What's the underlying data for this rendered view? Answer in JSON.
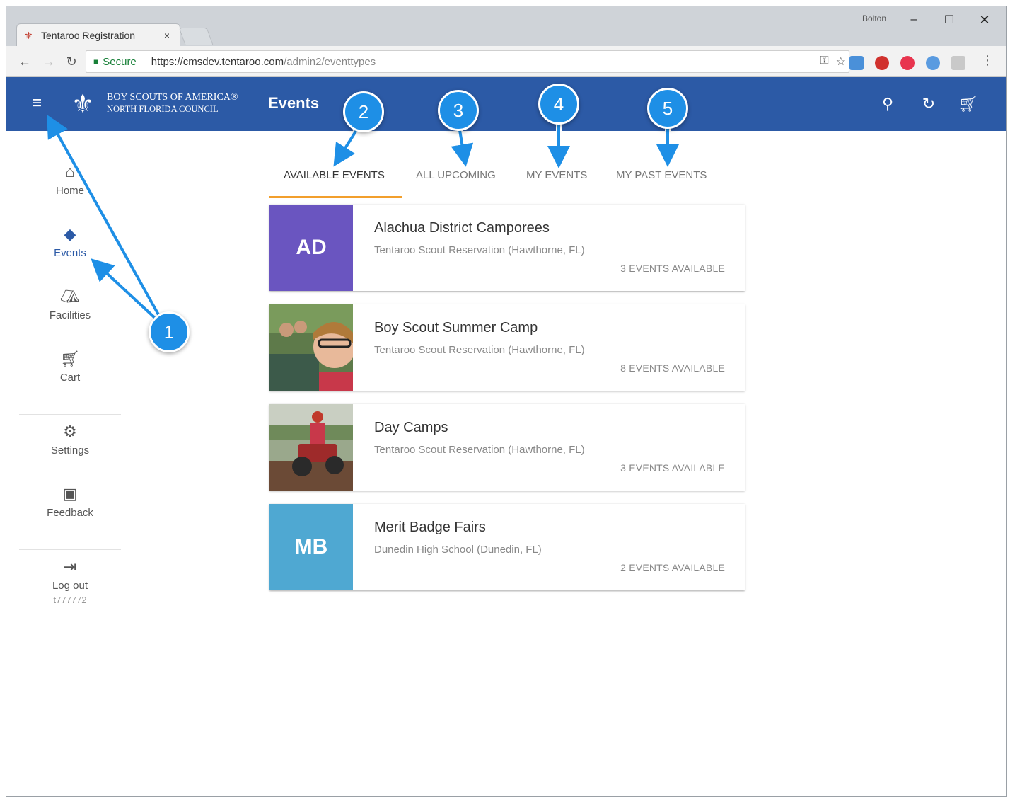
{
  "browser": {
    "tab_title": "Tentaroo Registration",
    "tab_close": "×",
    "user_chip": "Bolton",
    "window_min": "–",
    "window_max": "☐",
    "window_close": "✕",
    "secure_label": "Secure",
    "url_host": "https://cmsdev.tentaroo.com",
    "url_path": "/admin2/eventtypes"
  },
  "appbar": {
    "org_line1": "BOY SCOUTS OF AMERICA®",
    "org_line2": "NORTH FLORIDA COUNCIL",
    "title": "Events"
  },
  "sidebar": {
    "items": [
      {
        "label": "Home",
        "icon": "home-icon"
      },
      {
        "label": "Events",
        "icon": "events-icon",
        "active": true
      },
      {
        "label": "Facilities",
        "icon": "tent-icon"
      },
      {
        "label": "Cart",
        "icon": "cart-icon"
      },
      {
        "label": "Settings",
        "icon": "gear-icon"
      },
      {
        "label": "Feedback",
        "icon": "feedback-icon"
      },
      {
        "label": "Log out",
        "icon": "logout-icon"
      }
    ],
    "logout_id": "t777772"
  },
  "tabs": [
    {
      "label": "AVAILABLE EVENTS",
      "active": true
    },
    {
      "label": "ALL UPCOMING"
    },
    {
      "label": "MY EVENTS"
    },
    {
      "label": "MY PAST EVENTS"
    }
  ],
  "cards": [
    {
      "initials": "AD",
      "title": "Alachua District Camporees",
      "location": "Tentaroo Scout Reservation (Hawthorne, FL)",
      "count": "3 EVENTS AVAILABLE",
      "color": "#6a55c0"
    },
    {
      "initials": "",
      "title": "Boy Scout Summer Camp",
      "location": "Tentaroo Scout Reservation (Hawthorne, FL)",
      "count": "8 EVENTS AVAILABLE",
      "photo": "summer-camp-photo"
    },
    {
      "initials": "",
      "title": "Day Camps",
      "location": "Tentaroo Scout Reservation (Hawthorne, FL)",
      "count": "3 EVENTS AVAILABLE",
      "photo": "day-camp-photo"
    },
    {
      "initials": "MB",
      "title": "Merit Badge Fairs",
      "location": "Dunedin High School (Dunedin, FL)",
      "count": "2 EVENTS AVAILABLE",
      "color": "#4fa8d2"
    }
  ],
  "callouts": [
    "1",
    "2",
    "3",
    "4",
    "5"
  ],
  "colors": {
    "appbar": "#2c5aa6",
    "tab_indicator": "#f29f2c",
    "callout": "#1e8fe6"
  }
}
